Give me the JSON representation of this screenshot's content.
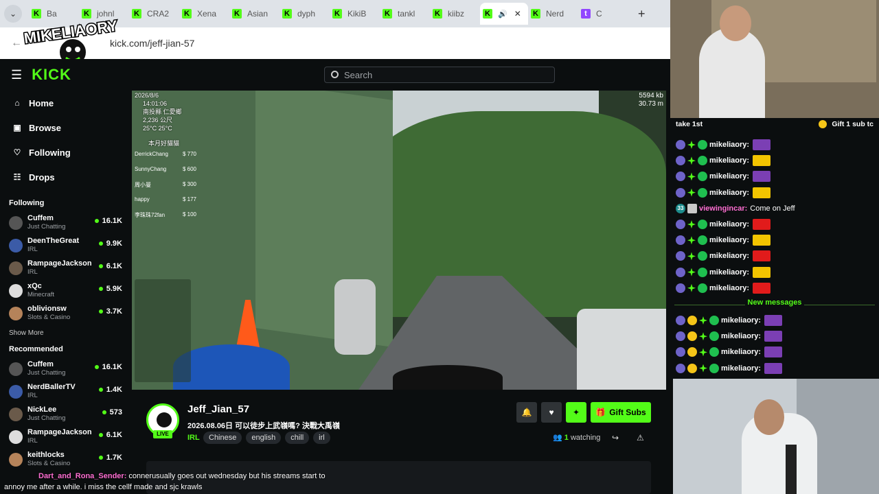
{
  "browser": {
    "tabs": [
      {
        "label": "Ba",
        "icon": "kick-favicon"
      },
      {
        "label": "johnl",
        "icon": "kick-favicon"
      },
      {
        "label": "CRA2",
        "icon": "kick-favicon"
      },
      {
        "label": "Xena",
        "icon": "kick-favicon"
      },
      {
        "label": "Asian",
        "icon": "kick-favicon"
      },
      {
        "label": "dyph",
        "icon": "kick-favicon"
      },
      {
        "label": "KikiB",
        "icon": "kick-favicon"
      },
      {
        "label": "tankl",
        "icon": "kick-favicon"
      },
      {
        "label": "kiibz",
        "icon": "kick-favicon"
      },
      {
        "label": "",
        "icon": "kick-favicon",
        "active": true
      },
      {
        "label": "Nerd",
        "icon": "kick-favicon"
      },
      {
        "label": "C",
        "icon": "twitch-favicon"
      }
    ],
    "url": "kick.com/jeff-jian-57",
    "overlay_logo_text": "MIKELIAORY"
  },
  "header": {
    "logo": "KICK",
    "search_placeholder": "Search"
  },
  "sidebar": {
    "nav": [
      {
        "label": "Home",
        "icon": "home-icon"
      },
      {
        "label": "Browse",
        "icon": "browse-icon"
      },
      {
        "label": "Following",
        "icon": "heart-icon"
      },
      {
        "label": "Drops",
        "icon": "drops-icon"
      }
    ],
    "following_title": "Following",
    "following": [
      {
        "name": "Cuffem",
        "category": "Just Chatting",
        "viewers": "16.1K"
      },
      {
        "name": "DeenTheGreat",
        "category": "IRL",
        "viewers": "9.9K"
      },
      {
        "name": "RampageJackson",
        "category": "IRL",
        "viewers": "6.1K"
      },
      {
        "name": "xQc",
        "category": "Minecraft",
        "viewers": "5.9K"
      },
      {
        "name": "oblivionsw",
        "category": "Slots & Casino",
        "viewers": "3.7K"
      }
    ],
    "show_more": "Show More",
    "recommended_title": "Recommended",
    "recommended": [
      {
        "name": "Cuffem",
        "category": "Just Chatting",
        "viewers": "16.1K"
      },
      {
        "name": "NerdBallerTV",
        "category": "IRL",
        "viewers": "1.4K"
      },
      {
        "name": "NickLee",
        "category": "Just Chatting",
        "viewers": "573"
      },
      {
        "name": "RampageJackson",
        "category": "IRL",
        "viewers": "6.1K"
      },
      {
        "name": "keithlocks",
        "category": "Slots & Casino",
        "viewers": "1.7K"
      }
    ]
  },
  "video_overlay": {
    "date": "2026/8/6",
    "time": "14:01:06",
    "location": "南投縣 仁愛鄉",
    "altitude": "2,236 公尺",
    "temp": "25°C  25°C",
    "board_title": "本月好貓貓",
    "donors": [
      {
        "name": "DerrickChang",
        "amount": "$ 770"
      },
      {
        "name": "SunnyChang",
        "amount": "$ 600"
      },
      {
        "name": "周小曼",
        "amount": "$ 300"
      },
      {
        "name": "happy",
        "amount": "$ 177"
      },
      {
        "name": "李珠珠72fan",
        "amount": "$ 100"
      }
    ],
    "stats_1": "5594 kb",
    "stats_2": "30.73 m"
  },
  "stream": {
    "name": "Jeff_Jian_57",
    "title": "2026.08.06日 可以徒步上武嶺嗎? 決戰大禹嶺",
    "category": "IRL",
    "tags": [
      "Chinese",
      "english",
      "chill",
      "irl"
    ],
    "live_label": "LIVE",
    "gift_subs": "Gift Subs",
    "watching_count": "1",
    "watching_label": "watching"
  },
  "bottom_overlay": {
    "user": "Dart_and_Rona_Sender:",
    "line1": " connerusually goes out wednesday but his streams start to",
    "line2": "annoy me after a while. i miss the cellf made and sjc krawls"
  },
  "chat": {
    "pinned_left": "take 1st",
    "pinned_right": "Gift 1 sub tc",
    "messages": [
      {
        "user": "mikeliaory:",
        "emote": "leaf",
        "badges": [
          "sub",
          "star",
          "verified"
        ]
      },
      {
        "user": "mikeliaory:",
        "emote": "wu",
        "badges": [
          "sub",
          "star",
          "verified"
        ]
      },
      {
        "user": "mikeliaory:",
        "emote": "leaf",
        "badges": [
          "sub",
          "star",
          "verified"
        ]
      },
      {
        "user": "mikeliaory:",
        "emote": "wu",
        "badges": [
          "sub",
          "star",
          "verified"
        ]
      },
      {
        "user": "viewingincar:",
        "text": "Come on Jeff",
        "badges": [
          "sub33",
          "card"
        ]
      },
      {
        "user": "mikeliaory:",
        "emote": "flag",
        "badges": [
          "sub",
          "star",
          "verified"
        ]
      },
      {
        "user": "mikeliaory:",
        "emote": "wu",
        "badges": [
          "sub",
          "star",
          "verified"
        ]
      },
      {
        "user": "mikeliaory:",
        "emote": "flag",
        "badges": [
          "sub",
          "star",
          "verified"
        ]
      },
      {
        "user": "mikeliaory:",
        "emote": "wu",
        "badges": [
          "sub",
          "star",
          "verified"
        ]
      },
      {
        "user": "mikeliaory:",
        "emote": "flag",
        "badges": [
          "sub",
          "star",
          "verified"
        ]
      }
    ],
    "new_messages_label": "New messages",
    "new_messages": [
      {
        "user": "mikeliaory:",
        "emote": "flag2",
        "badges": [
          "sub",
          "gold",
          "star",
          "verified"
        ]
      },
      {
        "user": "mikeliaory:",
        "emote": "leaf",
        "badges": [
          "sub",
          "gold",
          "star",
          "verified"
        ]
      },
      {
        "user": "mikeliaory:",
        "emote": "flag2",
        "badges": [
          "sub",
          "gold",
          "star",
          "verified"
        ]
      },
      {
        "user": "mikeliaory:",
        "emote": "leaf",
        "badges": [
          "sub",
          "gold",
          "star",
          "verified"
        ]
      }
    ],
    "viewingincar_badge": "33"
  },
  "colors": {
    "kick_green": "#53fc18",
    "bg": "#0b0e0f"
  }
}
